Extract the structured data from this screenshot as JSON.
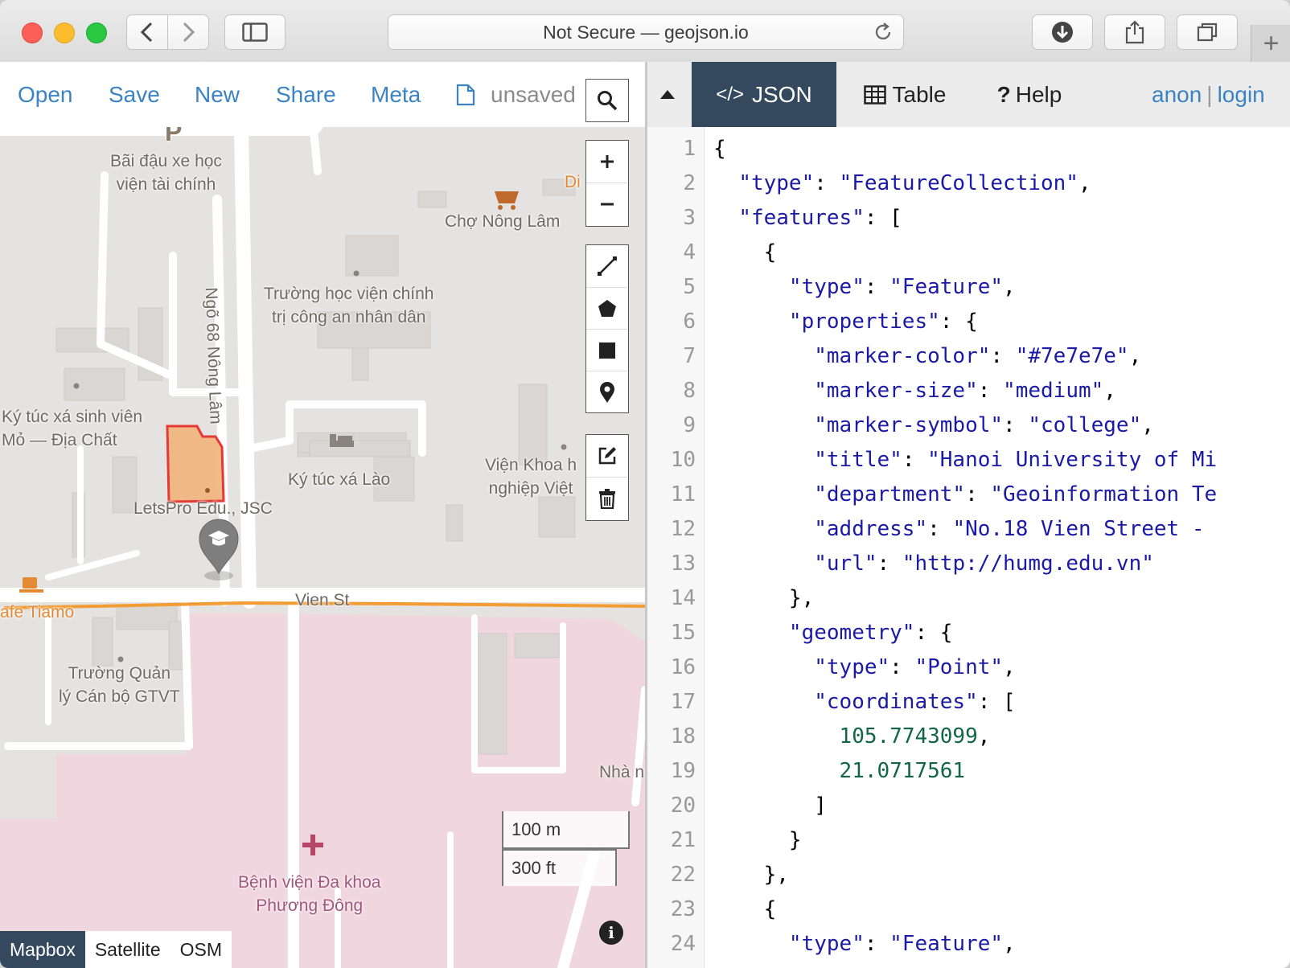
{
  "browser": {
    "address": "Not Secure — geojson.io",
    "new_tab": "+"
  },
  "menu": {
    "open": "Open",
    "save": "Save",
    "new": "New",
    "share": "Share",
    "meta": "Meta",
    "status": "unsaved"
  },
  "map": {
    "labels": {
      "parking_p": "P",
      "parking": "Bãi đậu xe học\nviện tài chính",
      "cho_nong_lam": "Chợ Nông Lâm",
      "dir_partial": "Di",
      "street_ngo68": "Ngõ 68 Nông Lâm",
      "truong_hoc_vien": "Trường học viện chính\ntrị công an nhân dân",
      "ktx_mo": "Ký túc xá sinh viên\nMỏ — Địa Chất",
      "ktx_lao": "Ký túc xá Lào",
      "vien_khoa": "Viện Khoa h\nnghiệp Việt",
      "letspro": "LetsPro Edu., JSC",
      "cafe": "afe Tiamo",
      "vien_st": "Vien St",
      "truong_quan": "Trường Quản\nlý Cán bộ GTVT",
      "nha": "Nhà n",
      "benh_vien": "Bệnh viện Đa khoa\nPhương Đông"
    },
    "scale_metric": "100 m",
    "scale_imperial": "300 ft",
    "layers": [
      "Mapbox",
      "Satellite",
      "OSM"
    ],
    "active_layer": "Mapbox",
    "polygon_fill": "#f0b27a",
    "polygon_stroke": "#e53935",
    "line_color": "#f39c34"
  },
  "panel": {
    "tabs": {
      "json": "JSON",
      "table": "Table",
      "help": "Help"
    },
    "auth": {
      "anon": "anon",
      "sep": "|",
      "login": "login"
    },
    "active_tab": "JSON"
  },
  "editor": {
    "lines": [
      {
        "n": "1",
        "t": "{"
      },
      {
        "n": "2",
        "t": "  \"type\": \"FeatureCollection\","
      },
      {
        "n": "3",
        "t": "  \"features\": ["
      },
      {
        "n": "4",
        "t": "    {"
      },
      {
        "n": "5",
        "t": "      \"type\": \"Feature\","
      },
      {
        "n": "6",
        "t": "      \"properties\": {"
      },
      {
        "n": "7",
        "t": "        \"marker-color\": \"#7e7e7e\","
      },
      {
        "n": "8",
        "t": "        \"marker-size\": \"medium\","
      },
      {
        "n": "9",
        "t": "        \"marker-symbol\": \"college\","
      },
      {
        "n": "10",
        "t": "        \"title\": \"Hanoi University of Mi"
      },
      {
        "n": "11",
        "t": "        \"department\": \"Geoinformation Te"
      },
      {
        "n": "12",
        "t": "        \"address\": \"No.18 Vien Street -"
      },
      {
        "n": "13",
        "t": "        \"url\": \"http://humg.edu.vn\""
      },
      {
        "n": "14",
        "t": "      },"
      },
      {
        "n": "15",
        "t": "      \"geometry\": {"
      },
      {
        "n": "16",
        "t": "        \"type\": \"Point\","
      },
      {
        "n": "17",
        "t": "        \"coordinates\": ["
      },
      {
        "n": "18",
        "t": "          105.7743099,"
      },
      {
        "n": "19",
        "t": "          21.0717561"
      },
      {
        "n": "20",
        "t": "        ]"
      },
      {
        "n": "21",
        "t": "      }"
      },
      {
        "n": "22",
        "t": "    },"
      },
      {
        "n": "23",
        "t": "    {"
      },
      {
        "n": "24",
        "t": "      \"type\": \"Feature\","
      }
    ]
  }
}
